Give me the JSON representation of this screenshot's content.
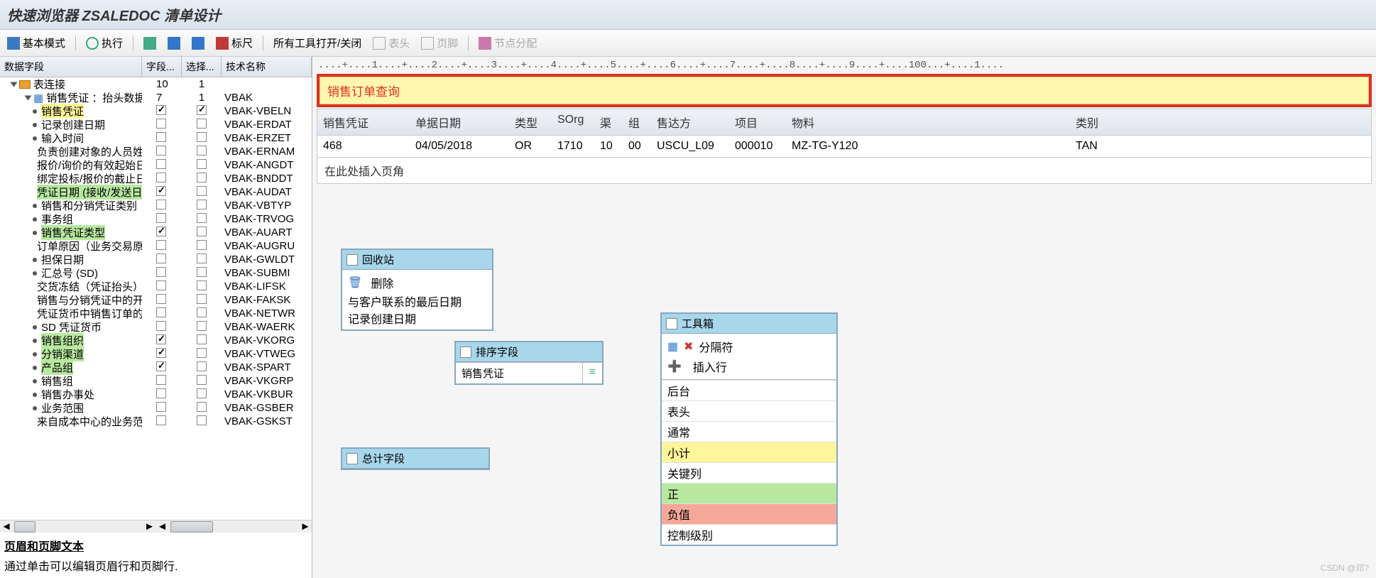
{
  "title": "快速浏览器 ZSALEDOC 清单设计",
  "toolbar": {
    "basic_mode": "基本模式",
    "execute": "执行",
    "ruler": "标尺",
    "toggle_tools": "所有工具打开/关闭",
    "header": "表头",
    "footer": "页脚",
    "node_assign": "节点分配"
  },
  "tree_headers": {
    "c0": "数据字段",
    "c1": "字段...",
    "c2": "选择...",
    "c3": "技术名称"
  },
  "tree_top": {
    "label": "表连接",
    "c1": "10",
    "c2": "1"
  },
  "tree_node2": {
    "label": "销售凭证 ：抬头数据",
    "c1": "7",
    "c2": "1",
    "c3": "VBAK"
  },
  "fields": [
    {
      "label": "销售凭证",
      "checked": true,
      "sel": true,
      "tech": "VBAK-VBELN",
      "hl": "hl-yellow"
    },
    {
      "label": "记录创建日期",
      "checked": false,
      "sel": false,
      "tech": "VBAK-ERDAT"
    },
    {
      "label": "输入时间",
      "checked": false,
      "sel": false,
      "tech": "VBAK-ERZET"
    },
    {
      "label": "负责创建对象的人员姓",
      "checked": false,
      "sel": false,
      "tech": "VBAK-ERNAM"
    },
    {
      "label": "报价/询价的有效起始日",
      "checked": false,
      "sel": false,
      "tech": "VBAK-ANGDT"
    },
    {
      "label": "绑定投标/报价的截止日",
      "checked": false,
      "sel": false,
      "tech": "VBAK-BNDDT"
    },
    {
      "label": "凭证日期 (接收/发送日",
      "checked": true,
      "sel": false,
      "tech": "VBAK-AUDAT",
      "hl": "hl-green"
    },
    {
      "label": "销售和分销凭证类别",
      "checked": false,
      "sel": false,
      "tech": "VBAK-VBTYP"
    },
    {
      "label": "事务组",
      "checked": false,
      "sel": false,
      "tech": "VBAK-TRVOG"
    },
    {
      "label": "销售凭证类型",
      "checked": true,
      "sel": false,
      "tech": "VBAK-AUART",
      "hl": "hl-green"
    },
    {
      "label": "订单原因（业务交易原",
      "checked": false,
      "sel": false,
      "tech": "VBAK-AUGRU"
    },
    {
      "label": "担保日期",
      "checked": false,
      "sel": false,
      "tech": "VBAK-GWLDT"
    },
    {
      "label": "汇总号 (SD)",
      "checked": false,
      "sel": false,
      "tech": "VBAK-SUBMI"
    },
    {
      "label": "交货冻结（凭证抬头）",
      "checked": false,
      "sel": false,
      "tech": "VBAK-LIFSK"
    },
    {
      "label": "销售与分销凭证中的开",
      "checked": false,
      "sel": false,
      "tech": "VBAK-FAKSK"
    },
    {
      "label": "凭证货币中销售订单的",
      "checked": false,
      "sel": false,
      "tech": "VBAK-NETWR"
    },
    {
      "label": "SD 凭证货币",
      "checked": false,
      "sel": false,
      "tech": "VBAK-WAERK"
    },
    {
      "label": "销售组织",
      "checked": true,
      "sel": false,
      "tech": "VBAK-VKORG",
      "hl": "hl-green"
    },
    {
      "label": "分销渠道",
      "checked": true,
      "sel": false,
      "tech": "VBAK-VTWEG",
      "hl": "hl-green"
    },
    {
      "label": "产品组",
      "checked": true,
      "sel": false,
      "tech": "VBAK-SPART",
      "hl": "hl-green"
    },
    {
      "label": "销售组",
      "checked": false,
      "sel": false,
      "tech": "VBAK-VKGRP"
    },
    {
      "label": "销售办事处",
      "checked": false,
      "sel": false,
      "tech": "VBAK-VKBUR"
    },
    {
      "label": "业务范围",
      "checked": false,
      "sel": false,
      "tech": "VBAK-GSBER"
    },
    {
      "label": "来自成本中心的业务范",
      "checked": false,
      "sel": false,
      "tech": "VBAK-GSKST"
    }
  ],
  "footer_help": {
    "hd": "页眉和页脚文本",
    "line": "通过单击可以编辑页眉行和页脚行."
  },
  "ruler_text": "....+....1....+....2....+....3....+....4....+....5....+....6....+....7....+....8....+....9....+....100...+....1....",
  "query_title": "销售订单查询",
  "report": {
    "headers": {
      "doc": "销售凭证",
      "date": "单据日期",
      "type": "类型",
      "sorg": "SOrg",
      "ch": "渠",
      "grp": "组",
      "ship": "售达方",
      "item": "项目",
      "mat": "物料",
      "cat": "类别"
    },
    "row": {
      "doc": "468",
      "date": "04/05/2018",
      "type": "OR",
      "sorg": "1710",
      "ch": "10",
      "grp": "00",
      "ship": "USCU_L09",
      "item": "000010",
      "mat": "MZ-TG-Y120",
      "cat": "TAN"
    },
    "footer": "在此处插入页角"
  },
  "recycle": {
    "title": "回收站",
    "del": "删除",
    "line1": "与客户联系的最后日期",
    "line2": "记录创建日期"
  },
  "sort": {
    "title": "排序字段",
    "field": "销售凭证"
  },
  "totals": {
    "title": "总计字段"
  },
  "toolbox": {
    "title": "工具箱",
    "sep": "分隔符",
    "ins": "插入行",
    "items": [
      {
        "label": "后台"
      },
      {
        "label": "表头"
      },
      {
        "label": "通常"
      },
      {
        "label": "小计",
        "cls": "c-yellow"
      },
      {
        "label": "关键列"
      },
      {
        "label": "正",
        "cls": "c-green"
      },
      {
        "label": "负值",
        "cls": "c-red"
      },
      {
        "label": "控制级别"
      }
    ]
  },
  "watermark": "CSDN @邓?"
}
